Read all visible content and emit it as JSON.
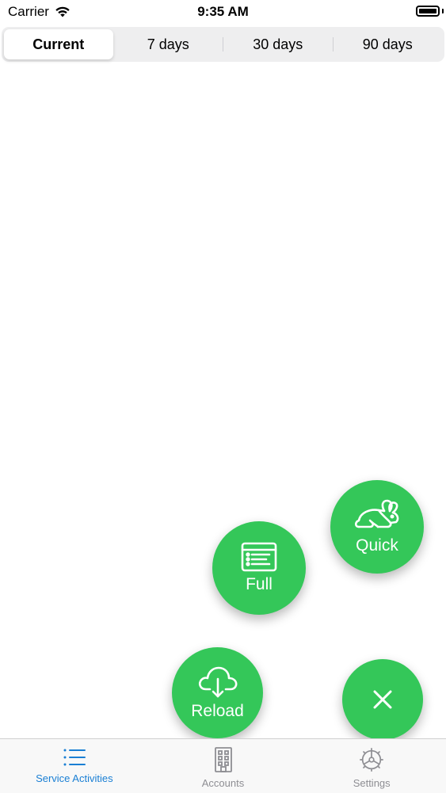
{
  "status_bar": {
    "carrier": "Carrier",
    "time": "9:35 AM"
  },
  "segments": [
    {
      "label": "Current",
      "active": true
    },
    {
      "label": "7 days",
      "active": false
    },
    {
      "label": "30 days",
      "active": false
    },
    {
      "label": "90 days",
      "active": false
    }
  ],
  "fab_menu": {
    "quick_label": "Quick",
    "full_label": "Full",
    "reload_label": "Reload",
    "quick_icon": "rabbit-icon",
    "full_icon": "list-icon",
    "reload_icon": "cloud-download-icon",
    "close_icon": "close-icon",
    "color": "#34c759"
  },
  "tab_bar": {
    "items": [
      {
        "label": "Service Activities",
        "icon": "list-icon",
        "active": true
      },
      {
        "label": "Accounts",
        "icon": "building-icon",
        "active": false
      },
      {
        "label": "Settings",
        "icon": "gear-icon",
        "active": false
      }
    ],
    "active_color": "#1a7fd4",
    "inactive_color": "#8e8e93"
  }
}
